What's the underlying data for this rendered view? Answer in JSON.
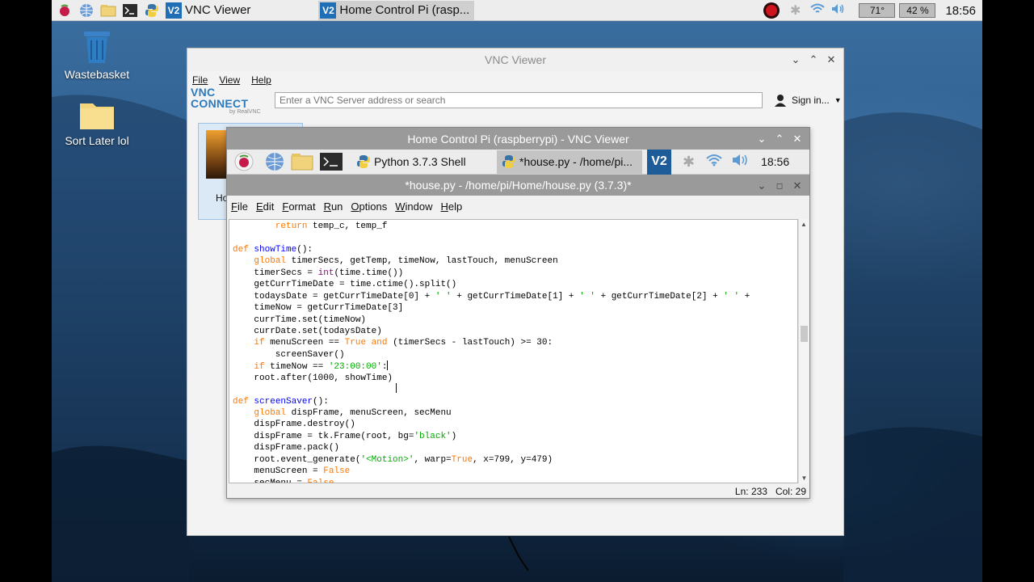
{
  "taskbar": {
    "tasks": [
      {
        "label": "VNC Viewer"
      },
      {
        "label": "Home Control Pi (rasp..."
      }
    ],
    "temperature": "71°",
    "cpu": "42 %",
    "clock": "18:56"
  },
  "desktop": {
    "icons": [
      {
        "label": "Wastebasket"
      },
      {
        "label": "Sort Later lol"
      }
    ]
  },
  "vnc_viewer": {
    "title": "VNC Viewer",
    "menu": [
      "File",
      "View",
      "Help"
    ],
    "logo": {
      "main": "VNC CONNECT",
      "sub": "by RealVNC"
    },
    "search_placeholder": "Enter a VNC Server address or search",
    "sign_in": "Sign in...",
    "thumb_label": "Ho"
  },
  "remote": {
    "title": "Home Control Pi (raspberrypi) - VNC Viewer",
    "panel": {
      "tasks": [
        {
          "label": "Python 3.7.3 Shell"
        },
        {
          "label": "*house.py - /home/pi..."
        }
      ],
      "clock": "18:56"
    },
    "editor": {
      "title": "*house.py - /home/pi/Home/house.py (3.7.3)*",
      "menu": [
        "File",
        "Edit",
        "Format",
        "Run",
        "Options",
        "Window",
        "Help"
      ],
      "status": {
        "line": "Ln: 233",
        "col": "Col: 29"
      }
    }
  },
  "colors": {
    "idle_keyword": "#ff7700",
    "idle_def": "#0000ff",
    "idle_builtin": "#900090",
    "idle_string": "#00aa00",
    "vnc_brand": "#2a7ac0"
  }
}
